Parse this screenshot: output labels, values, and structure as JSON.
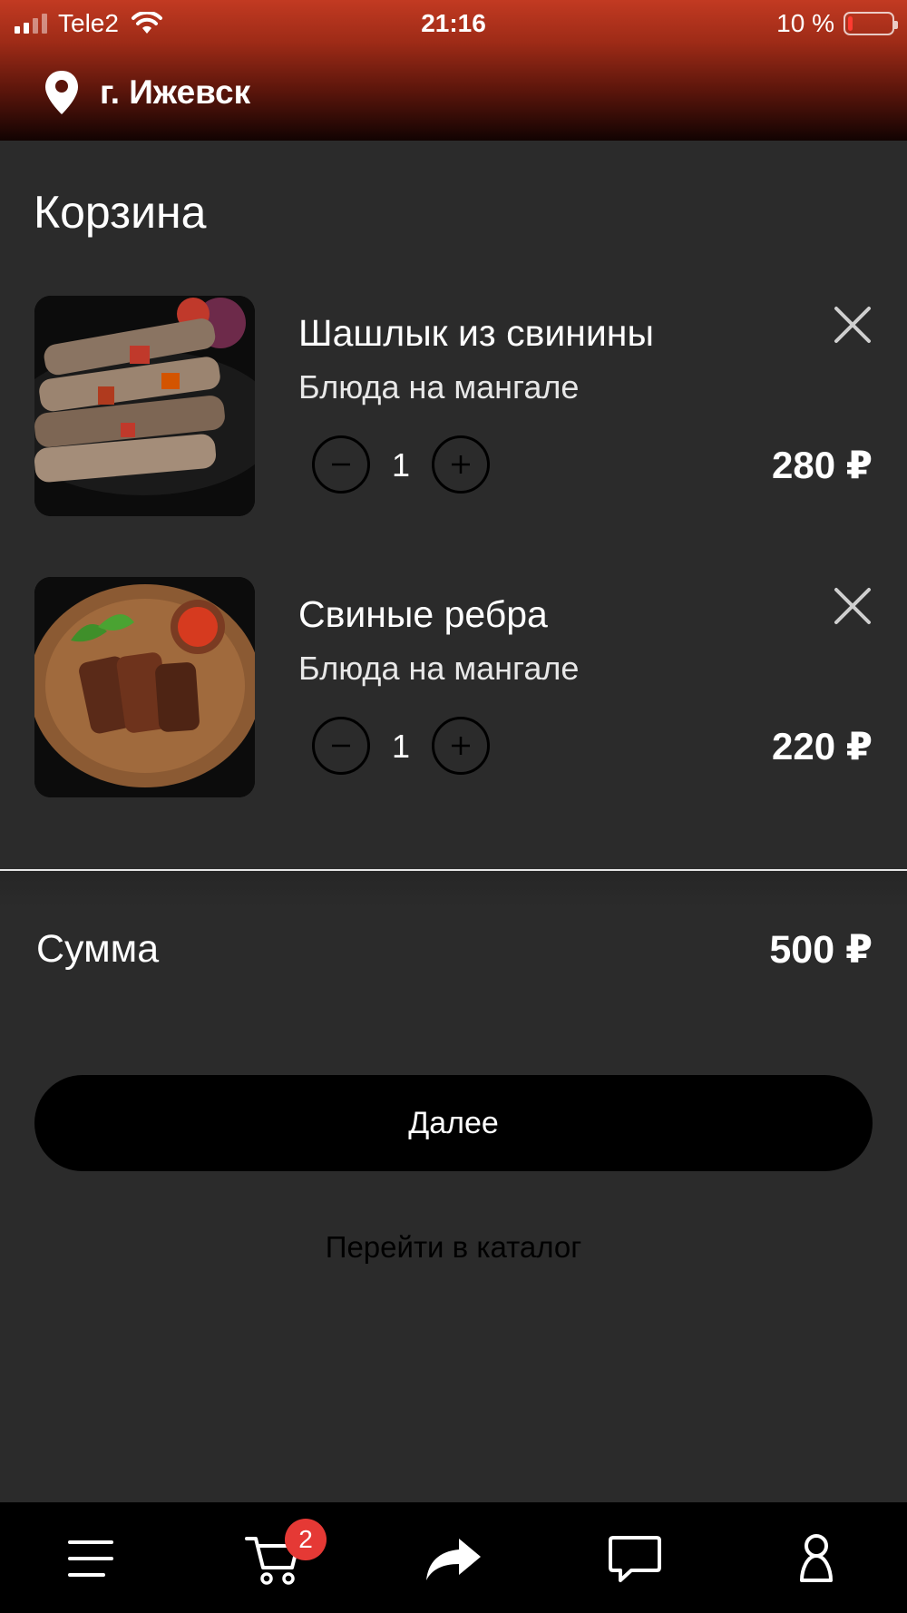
{
  "status_bar": {
    "carrier": "Tele2",
    "time": "21:16",
    "battery": "10 %",
    "battery_level": 0.1,
    "icons": [
      "signal-icon",
      "wifi-icon",
      "battery-icon"
    ]
  },
  "header": {
    "city": "г. Ижевск",
    "icon": "map-pin-icon"
  },
  "page": {
    "title": "Корзина"
  },
  "cart": {
    "items": [
      {
        "title": "Шашлык из свинины",
        "category": "Блюда на мангале",
        "quantity": "1",
        "price": "280 ₽",
        "image": "pork-shashlik-photo"
      },
      {
        "title": "Свиные ребра",
        "category": "Блюда на мангале",
        "quantity": "1",
        "price": "220 ₽",
        "image": "pork-ribs-photo"
      }
    ]
  },
  "summary": {
    "label": "Сумма",
    "total": "500 ₽"
  },
  "actions": {
    "next_label": "Далее",
    "catalog_label": "Перейти в каталог"
  },
  "tab_bar": {
    "cart_badge": "2",
    "tabs": [
      "menu-icon",
      "cart-icon",
      "share-icon",
      "chat-icon",
      "profile-icon"
    ]
  },
  "colors": {
    "header_top": "#c23a22",
    "background": "#2b2b2b",
    "button": "#000000",
    "badge": "#e53935"
  }
}
